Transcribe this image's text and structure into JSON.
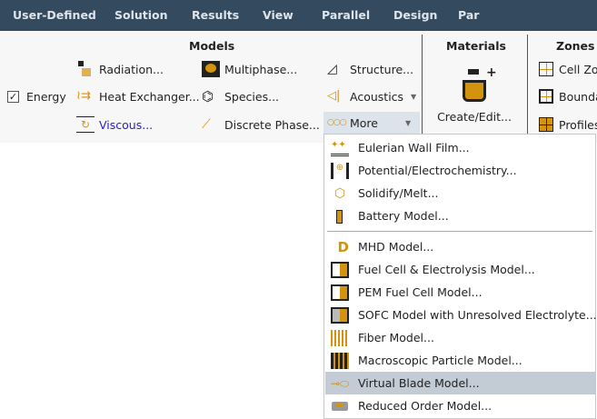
{
  "top_tabs": [
    "User-Defined",
    "Solution",
    "Results",
    "View",
    "Parallel",
    "Design",
    "Par"
  ],
  "models": {
    "title": "Models",
    "energy": {
      "label": "Energy",
      "checked": true
    },
    "radiation": "Radiation...",
    "heat_exchanger": "Heat Exchanger...",
    "viscous": "Viscous...",
    "multiphase": "Multiphase...",
    "species": "Species...",
    "discrete_phase": "Discrete Phase...",
    "structure": "Structure...",
    "acoustics": "Acoustics",
    "more": "More"
  },
  "materials": {
    "title": "Materials",
    "create_edit": "Create/Edit..."
  },
  "zones": {
    "title": "Zones",
    "cell_zones": "Cell Zo",
    "boundaries": "Bounda",
    "profiles": "Profiles"
  },
  "more_menu": {
    "items": [
      "Eulerian Wall Film...",
      "Potential/Electrochemistry...",
      "Solidify/Melt...",
      "Battery Model...",
      "MHD Model...",
      "Fuel Cell & Electrolysis Model...",
      "PEM Fuel Cell Model...",
      "SOFC Model with Unresolved Electrolyte...",
      "Fiber Model...",
      "Macroscopic Particle Model...",
      "Virtual Blade Model...",
      "Reduced Order Model..."
    ],
    "highlighted": "Virtual Blade Model..."
  },
  "colors": {
    "topbar": "#344a5f",
    "accent": "#d4930e",
    "highlight": "#c3cbd4",
    "link": "#2a1cd6"
  }
}
